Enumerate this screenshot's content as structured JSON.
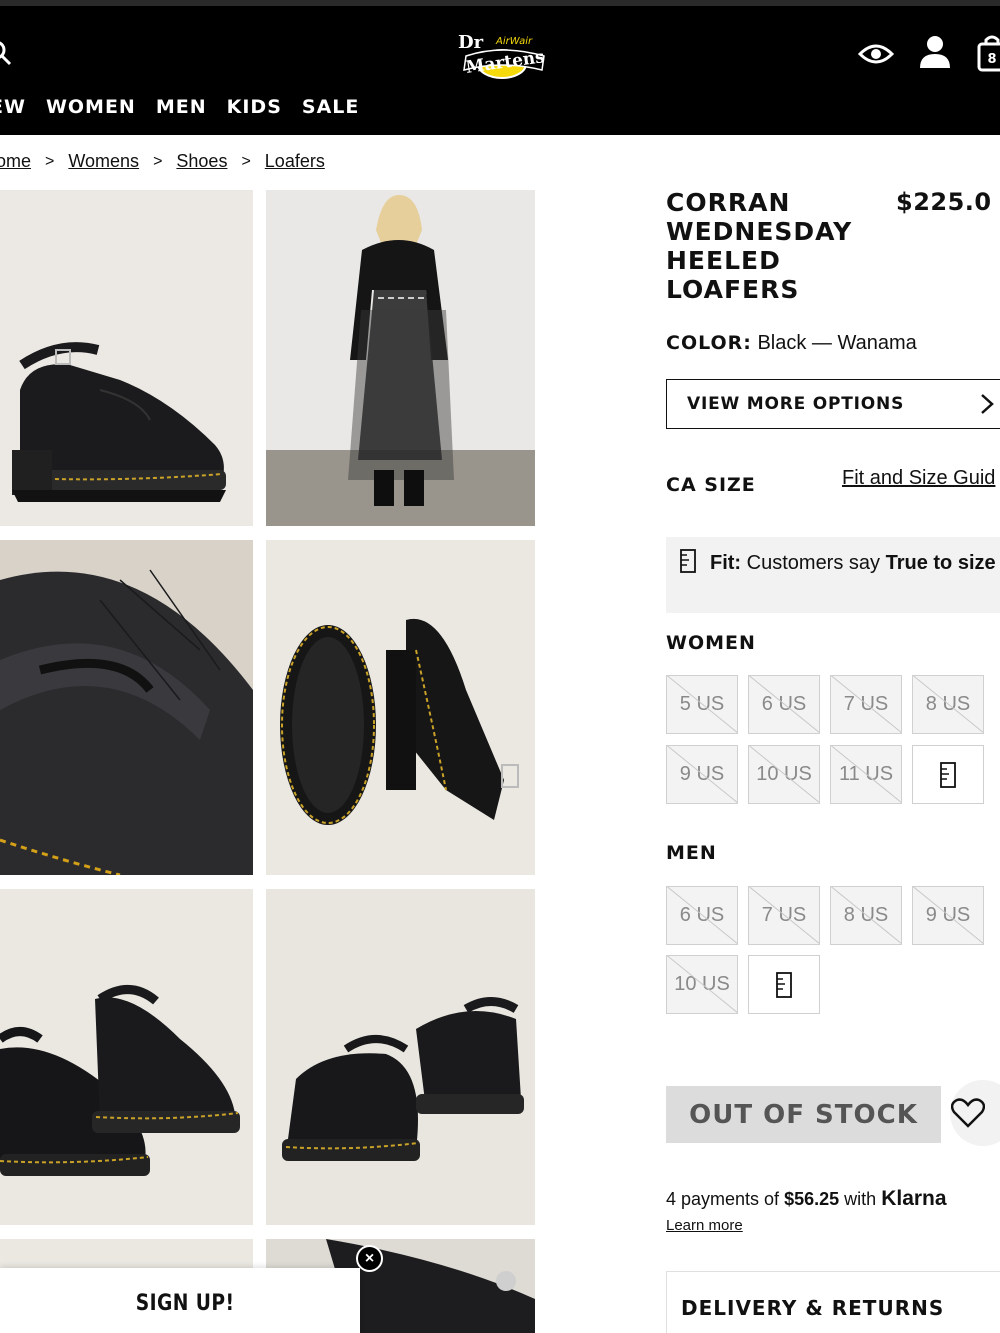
{
  "header": {
    "logo_text": "Dr. Martens AirWair",
    "icons": [
      "search-icon",
      "eye-icon",
      "user-icon",
      "bag-icon"
    ],
    "bag_count": "8",
    "nav": [
      "EW",
      "WOMEN",
      "MEN",
      "KIDS",
      "SALE"
    ]
  },
  "breadcrumb": {
    "items": [
      "ome",
      "Womens",
      "Shoes",
      "Loafers"
    ],
    "separator": ">"
  },
  "product": {
    "title": "CORRAN WEDNESDAY HEELED LOAFERS",
    "price": "$225.0",
    "color_label": "COLOR:",
    "color_value": "Black — Wanama",
    "view_more": "VIEW MORE OPTIONS",
    "size_label": "CA SIZE",
    "size_guide": "Fit and Size Guid",
    "fit": {
      "prefix": "Fit:",
      "text": "Customers say",
      "bold": "True to",
      "tail": "size"
    },
    "women_label": "WOMEN",
    "women_sizes": [
      "5 US",
      "6 US",
      "7 US",
      "8 US",
      "9 US",
      "10 US",
      "11 US"
    ],
    "men_label": "MEN",
    "men_sizes": [
      "6 US",
      "7 US",
      "8 US",
      "9 US",
      "10 US"
    ],
    "out_of_stock": "OUT OF STOCK",
    "klarna": {
      "prefix": "4 payments of",
      "amount": "$56.25",
      "with": "with",
      "brand": "Klarna",
      "learn_more": "Learn more"
    },
    "delivery": "DELIVERY & RETURNS"
  },
  "popup": {
    "signup": "SIGN UP!",
    "close": "×"
  },
  "colors": {
    "header_bg": "#000000",
    "logo_yellow": "#f5d90a",
    "out_of_stock_bg": "#dcdcdc"
  }
}
